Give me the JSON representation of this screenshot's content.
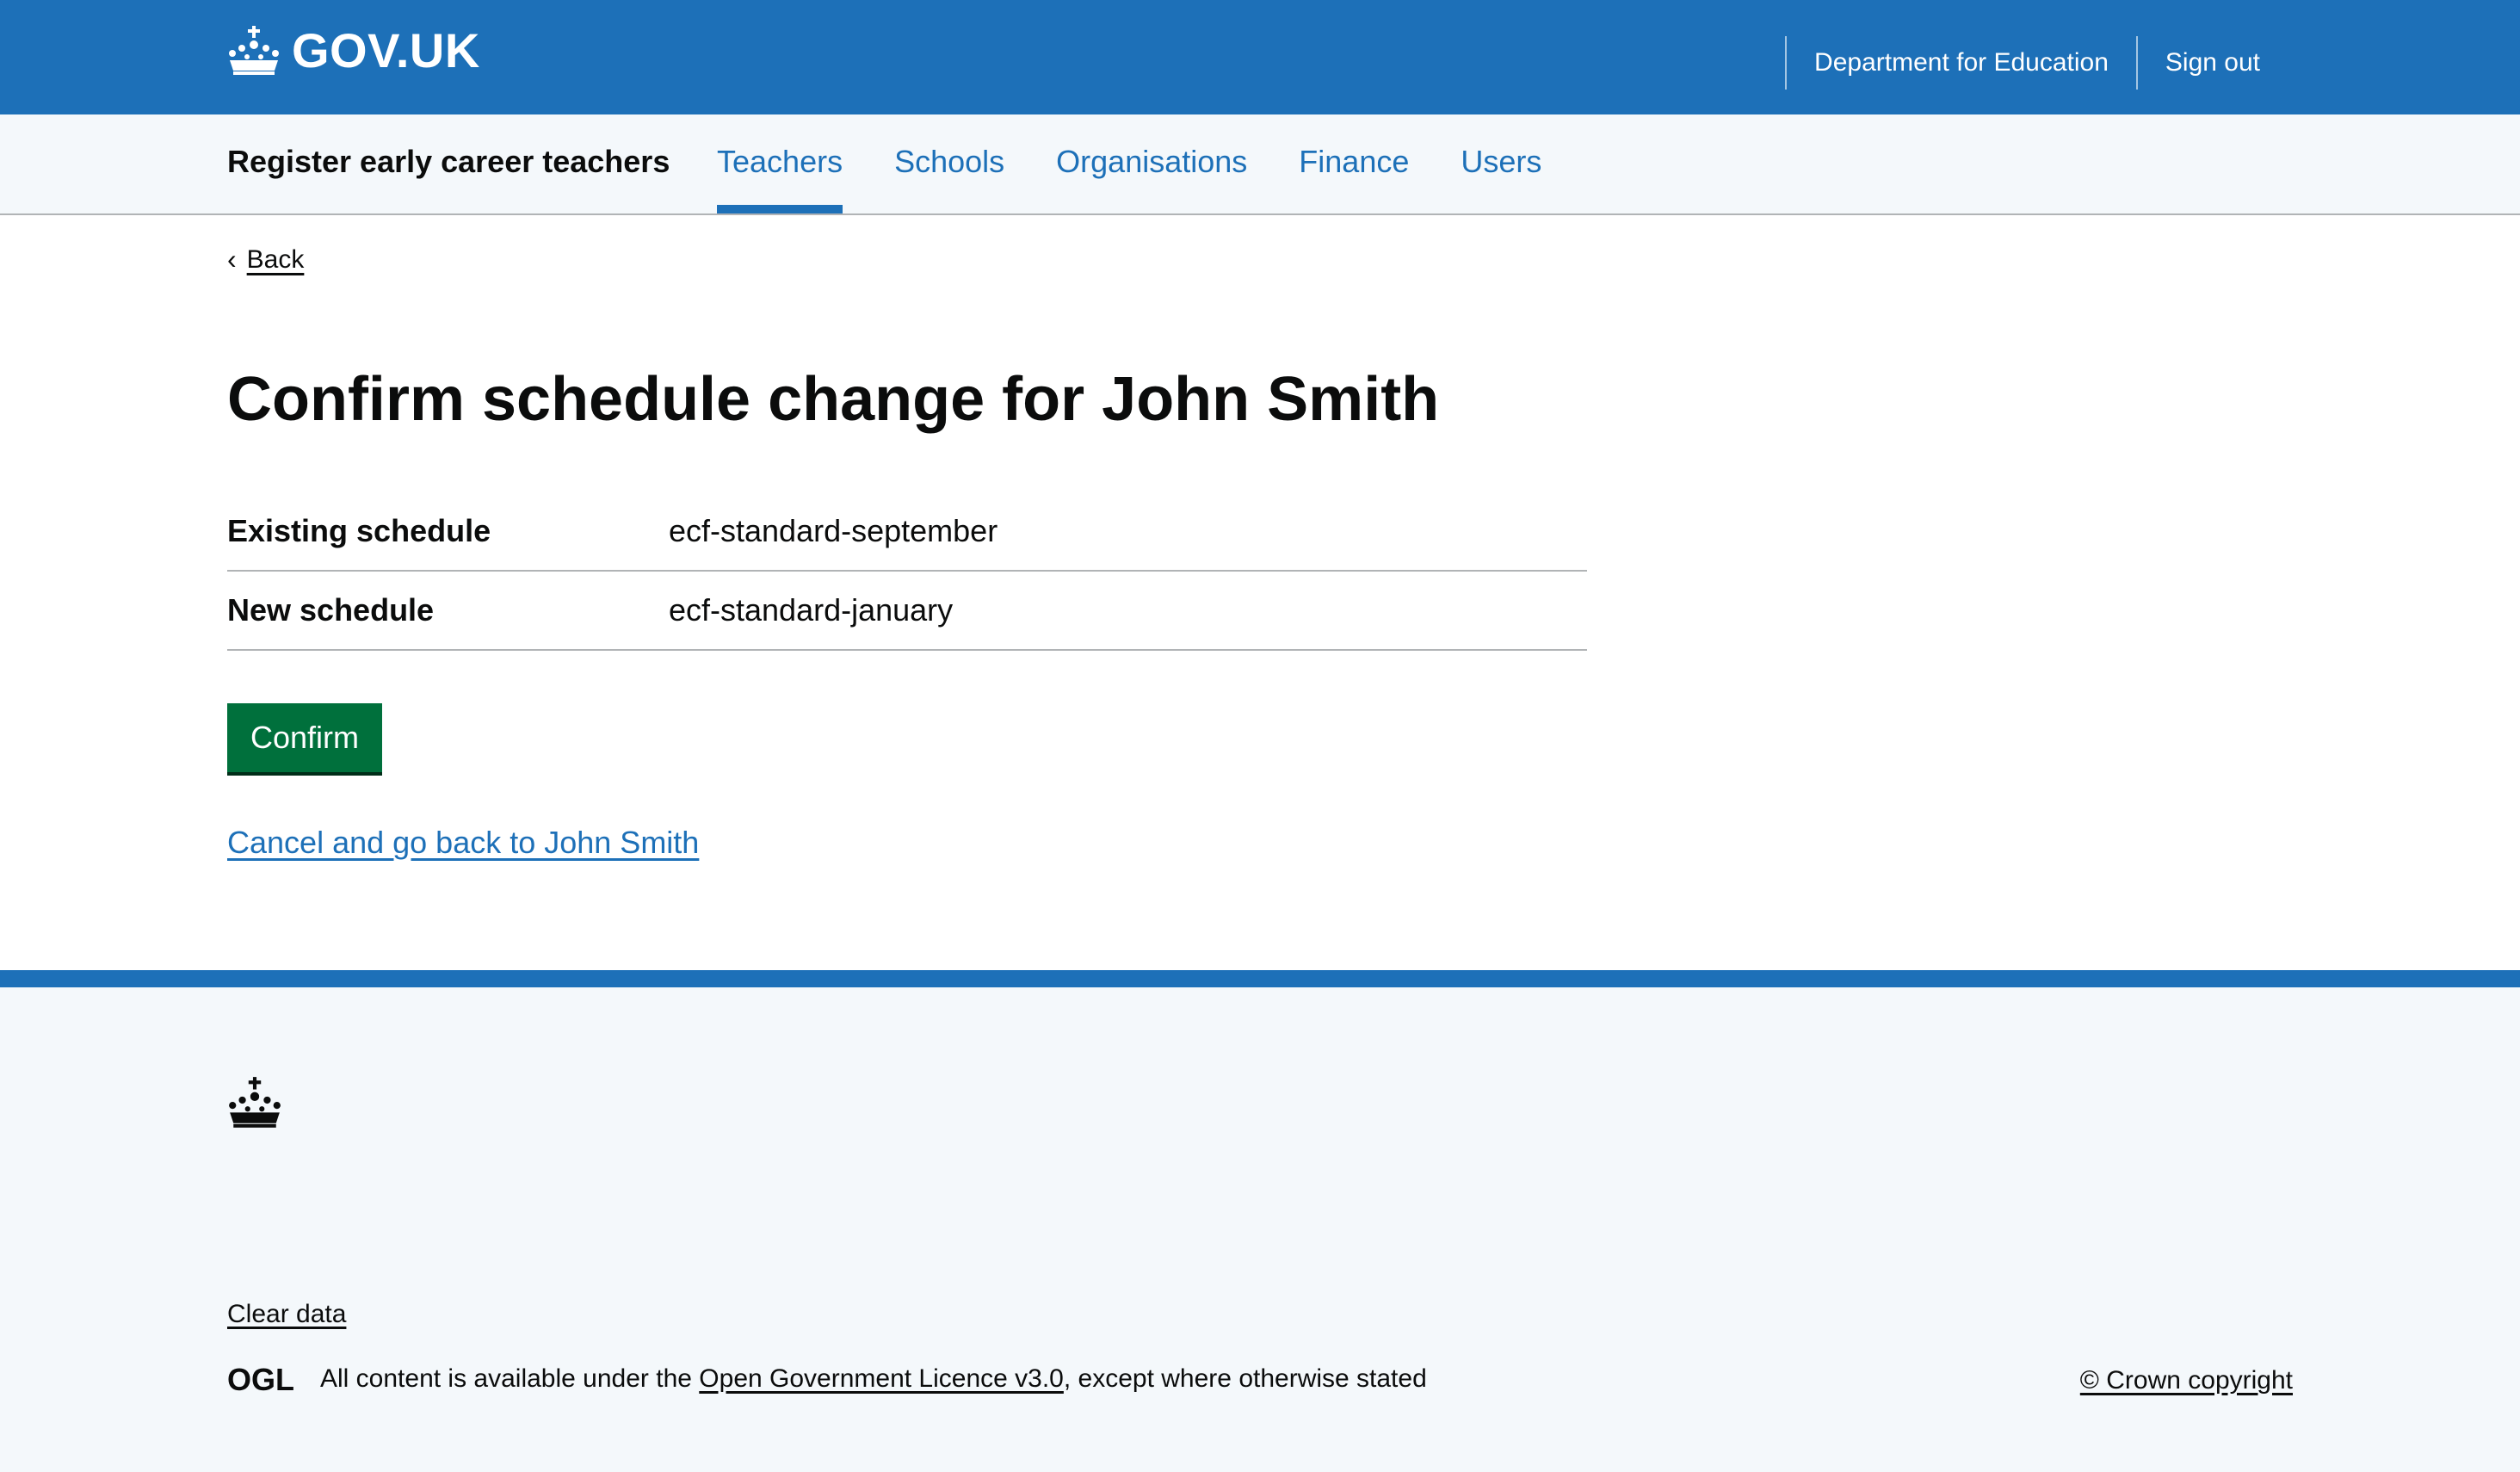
{
  "header": {
    "logo_text": "GOV.UK",
    "logo_icon": "crown-icon",
    "nav": [
      {
        "label": "Department for Education"
      },
      {
        "label": "Sign out"
      }
    ]
  },
  "service_nav": {
    "service_name": "Register early career teachers",
    "items": [
      {
        "label": "Teachers",
        "active": true
      },
      {
        "label": "Schools",
        "active": false
      },
      {
        "label": "Organisations",
        "active": false
      },
      {
        "label": "Finance",
        "active": false
      },
      {
        "label": "Users",
        "active": false
      }
    ]
  },
  "back_link": "Back",
  "page": {
    "title": "Confirm schedule change for John Smith",
    "summary": [
      {
        "key": "Existing schedule",
        "value": "ecf-standard-september"
      },
      {
        "key": "New schedule",
        "value": "ecf-standard-january"
      }
    ],
    "confirm_button": "Confirm",
    "cancel_link": "Cancel and go back to John Smith"
  },
  "footer": {
    "crest_icon": "crown-icon",
    "clear_data": "Clear data",
    "ogl_logo_text": "OGL",
    "licence_prefix": "All content is available under the",
    "licence_link": "Open Government Licence v3.0",
    "licence_suffix": ", except where otherwise stated",
    "copyright": "© Crown copyright"
  },
  "colors": {
    "brand_blue": "#1d70b8",
    "button_green": "#00703c",
    "text": "#0b0c0c",
    "footer_bg": "#f4f8fb"
  }
}
